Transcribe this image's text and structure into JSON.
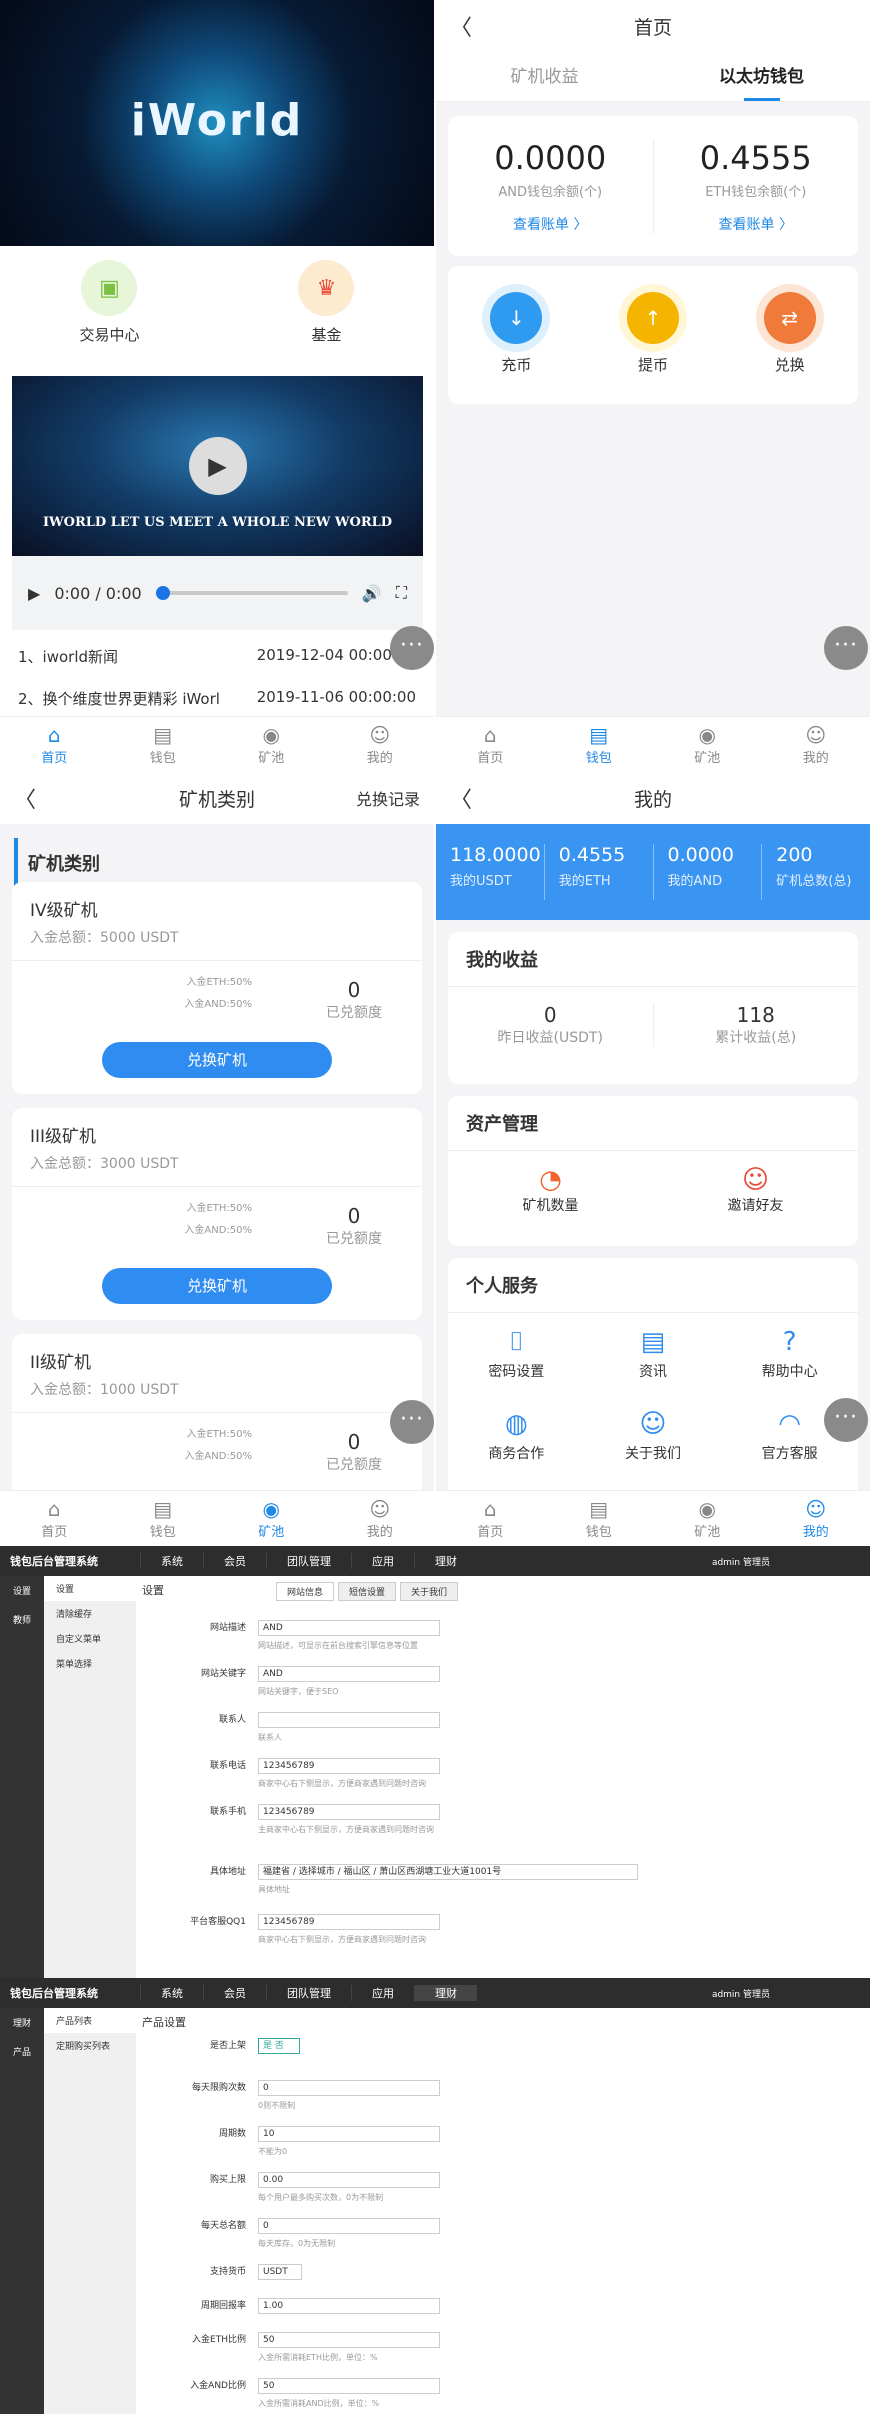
{
  "home": {
    "hero_title": "iWorld",
    "nav": [
      {
        "label": "交易中心",
        "color": "#7cc242",
        "bg": "#e7f5d8"
      },
      {
        "label": "基金",
        "color": "#e94d3a",
        "bg": "#fdebd0"
      }
    ],
    "video_caption": "IWORLD LET US MEET A WHOLE NEW WORLD",
    "time": "0:00 / 0:00",
    "news": [
      {
        "title": "1、iworld新闻",
        "date": "2019-12-04 00:00:00"
      },
      {
        "title": "2、换个维度世界更精彩 iWorl",
        "date": "2019-11-06 00:00:00"
      }
    ]
  },
  "tabs": [
    "首页",
    "钱包",
    "矿池",
    "我的"
  ],
  "wallet": {
    "title": "首页",
    "subtabs": [
      "矿机收益",
      "以太坊钱包"
    ],
    "bal": [
      {
        "n": "0.0000",
        "l": "AND钱包余额(个)",
        "a": "查看账单 〉"
      },
      {
        "n": "0.4555",
        "l": "ETH钱包余额(个)",
        "a": "查看账单 〉"
      }
    ],
    "ops": [
      {
        "label": "充币",
        "color": "#2f9bf0",
        "bg": "#dff0fd"
      },
      {
        "label": "提币",
        "color": "#f4b400",
        "bg": "#fff6d6"
      },
      {
        "label": "兑换",
        "color": "#f07a3a",
        "bg": "#fde5d6"
      }
    ]
  },
  "miners": {
    "title": "矿机类别",
    "right": "兑换记录",
    "section": "矿机类别",
    "cards": [
      {
        "h": "IV级矿机",
        "s": "入金总额：5000 USDT",
        "r1": "入金ETH:50%",
        "r2": "入金AND:50%",
        "q": "0",
        "ql": "已兑额度",
        "btn": "兑换矿机"
      },
      {
        "h": "III级矿机",
        "s": "入金总额：3000 USDT",
        "r1": "入金ETH:50%",
        "r2": "入金AND:50%",
        "q": "0",
        "ql": "已兑额度",
        "btn": "兑换矿机"
      },
      {
        "h": "II级矿机",
        "s": "入金总额：1000 USDT",
        "r1": "入金ETH:50%",
        "r2": "入金AND:50%",
        "q": "0",
        "ql": "已兑额度",
        "btn": ""
      }
    ]
  },
  "mine": {
    "title": "我的",
    "stats": [
      {
        "v": "118.0000",
        "k": "我的USDT"
      },
      {
        "v": "0.4555",
        "k": "我的ETH"
      },
      {
        "v": "0.0000",
        "k": "我的AND"
      },
      {
        "v": "200",
        "k": "矿机总数(总)"
      }
    ],
    "income_title": "我的收益",
    "income": [
      {
        "v": "0",
        "k": "昨日收益(USDT)"
      },
      {
        "v": "118",
        "k": "累计收益(总)"
      }
    ],
    "asset_title": "资产管理",
    "assets": [
      "矿机数量",
      "邀请好友"
    ],
    "service_title": "个人服务",
    "services": [
      "密码设置",
      "资讯",
      "帮助中心",
      "商务合作",
      "关于我们",
      "官方客服"
    ]
  },
  "admin1": {
    "brand": "钱包后台管理系统",
    "menu": [
      "系统",
      "会员",
      "团队管理",
      "应用",
      "理财"
    ],
    "user": "admin 管理员",
    "side": [
      "设置",
      "教师"
    ],
    "sub": [
      "设置",
      "清除缓存",
      "自定义菜单",
      "菜单选择"
    ],
    "crumb": "设置",
    "tabs": [
      "网站信息",
      "短信设置",
      "关于我们"
    ],
    "rows": [
      {
        "l": "网站描述",
        "v": "AND",
        "h": "网站描述，可显示在前台搜索引擎信息等位置"
      },
      {
        "l": "网站关键字",
        "v": "AND",
        "h": "网站关键字，便于SEO"
      },
      {
        "l": "联系人",
        "v": "",
        "h": "联系人"
      },
      {
        "l": "联系电话",
        "v": "123456789",
        "h": "商家中心右下侧显示，方便商家遇到问题时咨询"
      },
      {
        "l": "联系手机",
        "v": "123456789",
        "h": "主商家中心右下侧显示，方便商家遇到问题时咨询"
      },
      {
        "l": "具体地址",
        "v": "福建省 / 选择城市 / 福山区 / 萧山区西湖塘工业大道1001号",
        "h": "具体地址"
      },
      {
        "l": "平台客服QQ1",
        "v": "123456789",
        "h": "商家中心右下侧显示，方便商家遇到问题时咨询"
      }
    ]
  },
  "admin2": {
    "brand": "钱包后台管理系统",
    "menu": [
      "系统",
      "会员",
      "团队管理",
      "应用",
      "理财"
    ],
    "user": "admin 管理员",
    "side": [
      "理财",
      "产品"
    ],
    "sub": [
      "产品列表",
      "定期购买列表"
    ],
    "crumb": "产品设置",
    "rows": [
      {
        "l": "是否上架",
        "v": "是 否",
        "h": ""
      },
      {
        "l": "每天限购次数",
        "v": "0",
        "h": "0则不限制"
      },
      {
        "l": "周期数",
        "v": "10",
        "h": "不能为0"
      },
      {
        "l": "购买上限",
        "v": "0.00",
        "h": "每个用户最多购买次数，0为不限制"
      },
      {
        "l": "每天总名额",
        "v": "0",
        "h": "每天库存，0为无限制"
      },
      {
        "l": "支持货币",
        "v": "USDT",
        "h": ""
      },
      {
        "l": "周期回报率",
        "v": "1.00",
        "h": ""
      },
      {
        "l": "入金ETH比例",
        "v": "50",
        "h": "入金所需消耗ETH比例，单位：%"
      },
      {
        "l": "入金AND比例",
        "v": "50",
        "h": "入金所需消耗AND比例，单位：%"
      }
    ]
  }
}
